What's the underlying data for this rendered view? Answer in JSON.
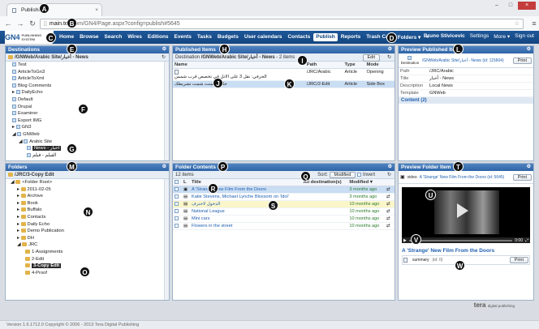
{
  "browser": {
    "tab_title": "Publishing",
    "url_host": "main.te",
    "url_path": ".com/GN4/Page.aspx?config=publish#5645"
  },
  "app": {
    "logo_text": "GN4",
    "logo_sub": "PUBLISHING SYSTEM",
    "menu": [
      "Home",
      "Browse",
      "Search",
      "Wires",
      "Editions",
      "Events",
      "Tasks",
      "Budgets",
      "User calendars",
      "Contacts",
      "Publish",
      "Reports",
      "Trash Can",
      "Folders ▾",
      "»"
    ],
    "user": "Bruno Stivicevic",
    "settings": "Settings",
    "more": "More ▾",
    "signout": "Sign out"
  },
  "destinations": {
    "title": "Destinations",
    "path": "/GNWeb/Arabic Site/أخبار - News",
    "items": [
      "Test",
      "ArticleToGn3",
      "ArticleToXml",
      "Blog Comments",
      "DailyEcho",
      "Default",
      "Drupal",
      "Examiner",
      "Export IMG",
      "GN3",
      "GNWeb",
      "Arabic Site",
      "News - أخبار",
      "الفيلم - فيلم"
    ]
  },
  "folders": {
    "title": "Folders",
    "path": "/JRC/3-Copy Edit",
    "items": [
      "<Folder Root>",
      "2011-02-05",
      "Archive",
      "Book",
      "Buffalo",
      "Contacts",
      "Daily Echo",
      "Demo Publication",
      "DH",
      "JRC",
      "1-Assignments",
      "2-Edit",
      "3-Copy Edit",
      "4-Proof"
    ]
  },
  "published": {
    "title": "Published Items",
    "destination_label": "Destination",
    "destination_value": "/GNWeb/Arabic Site/أخبار - News",
    "count": "2 items",
    "edit": "Edit",
    "headers": [
      "Name",
      "Path",
      "Type",
      "Mode"
    ],
    "rows": [
      {
        "name": "الحرفي: نقل 3 على الاتل في تخصص قرب شمس",
        "path": "/JRC/Arabic",
        "type": "Article",
        "mode": "Opening"
      },
      {
        "name": "حلقة ضمنت شمت تشريطك",
        "path": "/JRC/2-Edit",
        "type": "Article",
        "mode": "Side Box"
      }
    ]
  },
  "preview_pub": {
    "title": "Preview Published Item",
    "dest_label": "Destination",
    "dest_value": "/GNWeb/Arabic Site/أخبار - News (id: 115604)",
    "print": "Print",
    "fields": [
      {
        "k": "Path",
        "v": "/JRC/Arabic"
      },
      {
        "k": "Title",
        "v": "أخبار - News"
      },
      {
        "k": "Description",
        "v": "Local News"
      },
      {
        "k": "Template",
        "v": "GNWeb"
      }
    ],
    "content": "Content (2)"
  },
  "folder_contents": {
    "title": "Folder Contents",
    "count": "12 items",
    "sort_label": "Sort:",
    "sort_value": "Modified",
    "invert": "Invert",
    "headers": [
      "L",
      "Title",
      "All destination(s)",
      "Modified ▾"
    ],
    "rows": [
      {
        "title": "A 'Strange' New Film From the Doors",
        "modified": "3 months ago"
      },
      {
        "title": "Katie Stevens, Michael Lynche Blossom on 'Idol'",
        "modified": "3 months ago"
      },
      {
        "title": "الدخول لاحترف",
        "modified": "10 months ago"
      },
      {
        "title": "National League",
        "modified": "10 months ago"
      },
      {
        "title": "Mini cars",
        "modified": "10 months ago"
      },
      {
        "title": "Flowers in the street",
        "modified": "10 months ago"
      }
    ]
  },
  "preview_folder": {
    "title": "Preview Folder Item",
    "type": "video",
    "link": "A 'Strange' New Film From the Doors (id: 5645)",
    "print": "Print",
    "caption": "A 'Strange' New Film From the Doors",
    "summary_label": "summary",
    "summary_id": "(id: 0)",
    "time": "0:00"
  },
  "footer": "Version 1.6.1712.0 Copyright © 2006 - 2013 Tera Digital Publishing",
  "brand": "tera",
  "brand_sub": "digital publishing",
  "badges": [
    "A",
    "B",
    "C",
    "D",
    "E",
    "F",
    "G",
    "H",
    "I",
    "J",
    "K",
    "L",
    "M",
    "N",
    "O",
    "P",
    "Q",
    "R",
    "S",
    "T",
    "U",
    "V",
    "W"
  ],
  "colors": {
    "header": "#1e5799",
    "panel_head": "#3a6fb0",
    "selected_row": "#c9ddf3"
  }
}
